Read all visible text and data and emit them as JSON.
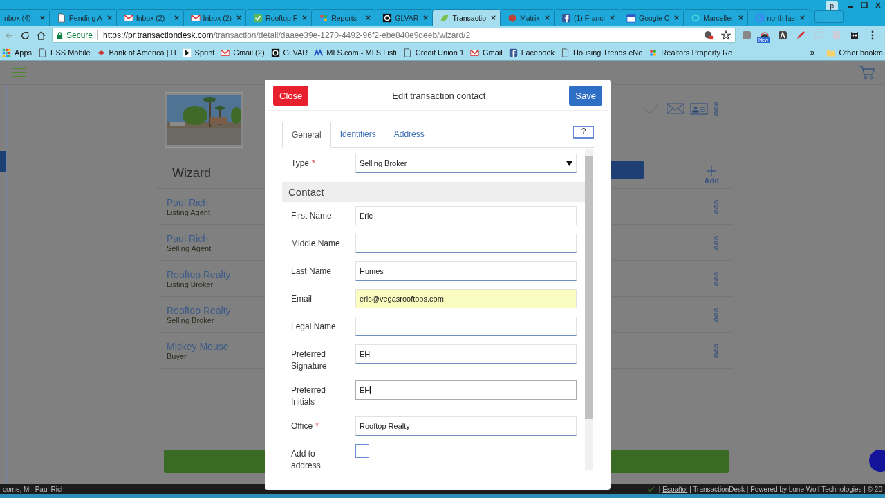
{
  "window": {
    "user_badge": "p"
  },
  "tabs": [
    {
      "title": "Inbox (4) -",
      "selected": false
    },
    {
      "title": "Pending A",
      "kind": "doc",
      "selected": false
    },
    {
      "title": "Inbox (2) -",
      "kind": "mail",
      "selected": false
    },
    {
      "title": "Inbox (2)",
      "kind": "mail",
      "selected": false
    },
    {
      "title": "Rooftop F",
      "kind": "check",
      "selected": false
    },
    {
      "title": "Reports -",
      "kind": "dots",
      "selected": false
    },
    {
      "title": "GLVAR",
      "kind": "box",
      "selected": false
    },
    {
      "title": "Transactio",
      "kind": "leaf",
      "selected": true
    },
    {
      "title": "Matrix",
      "kind": "cube",
      "selected": false
    },
    {
      "title": "(1) Franci",
      "kind": "social",
      "selected": false
    },
    {
      "title": "Google C",
      "kind": "calendar",
      "selected": false
    },
    {
      "title": "Marceller",
      "kind": "ring",
      "selected": false
    },
    {
      "title": "north las",
      "kind": "globe",
      "selected": false
    }
  ],
  "toolbar": {
    "secure_label": "Secure",
    "url_host": "https://pr.transactiondesk.com",
    "url_path": "/transaction/detail/daaee39e-1270-4492-96f2-ebe840e9deeb/wizard/2",
    "extension_badge": "New"
  },
  "bookmarks": [
    {
      "label": "Apps",
      "kind": "grid"
    },
    {
      "label": "ESS Mobile",
      "kind": "doc"
    },
    {
      "label": "Bank of America | H",
      "kind": "flag"
    },
    {
      "label": "Sprint",
      "kind": "play"
    },
    {
      "label": "Gmail (2)",
      "kind": "mail"
    },
    {
      "label": "GLVAR",
      "kind": "box"
    },
    {
      "label": "MLS.com - MLS Listi",
      "kind": "wave"
    },
    {
      "label": "Credit Union 1",
      "kind": "doc"
    },
    {
      "label": "Gmail",
      "kind": "mail"
    },
    {
      "label": "Facebook",
      "kind": "social"
    },
    {
      "label": "Housing Trends eNe",
      "kind": "doc"
    },
    {
      "label": "Realtors Property Re",
      "kind": "dots"
    }
  ],
  "bookmarks_overflow": "»",
  "other_bookmarks": "Other bookm",
  "page": {
    "wizard_title": "Wizard",
    "add_label": "Add",
    "contacts": [
      {
        "name": "Paul Rich",
        "role": "Listing Agent"
      },
      {
        "name": "Paul Rich",
        "role": "Selling Agent"
      },
      {
        "name": "Rooftop Realty",
        "role": "Listing Broker"
      },
      {
        "name": "Rooftop Realty",
        "role": "Selling Broker"
      },
      {
        "name": "Mickey Mouse",
        "role": "Buyer"
      }
    ],
    "welcome": "come, Mr. Paul Rich",
    "footer_prefix": "|",
    "footer_link": "Español",
    "footer_text": "| TransactionDesk | Powered by Lone Wolf Technologies | © 20"
  },
  "dialog": {
    "close": "Close",
    "title": "Edit transaction contact",
    "save": "Save",
    "tabs": [
      {
        "label": "General",
        "selected": true
      },
      {
        "label": "Identifiers",
        "selected": false
      },
      {
        "label": "Address",
        "selected": false
      }
    ],
    "help": "?",
    "required_mark": "*",
    "fields": [
      {
        "kind": "select",
        "label": "Type",
        "required": true,
        "value": "Selling Broker"
      },
      {
        "kind": "section",
        "label": "Contact"
      },
      {
        "kind": "text",
        "label": "First Name",
        "required": false,
        "autofilled": false,
        "focused": false,
        "value": "Eric"
      },
      {
        "kind": "text",
        "label": "Middle Name",
        "required": false,
        "autofilled": false,
        "focused": false
      },
      {
        "kind": "text",
        "label": "Last Name",
        "required": false,
        "autofilled": false,
        "focused": false,
        "value": "Humes"
      },
      {
        "kind": "text",
        "label": "Email",
        "required": false,
        "autofilled": true,
        "focused": false,
        "value": "eric@vegasrooftops.com"
      },
      {
        "kind": "text",
        "label": "Legal Name",
        "required": false,
        "autofilled": false,
        "focused": false
      },
      {
        "kind": "text",
        "label": "Preferred Signature",
        "required": false,
        "autofilled": false,
        "focused": false,
        "value": "EH"
      },
      {
        "kind": "text",
        "label": "Preferred Initials",
        "required": false,
        "autofilled": false,
        "focused": true,
        "value": "EH"
      },
      {
        "kind": "text",
        "label": "Office",
        "required": true,
        "autofilled": false,
        "focused": false,
        "value": "Rooftop Realty"
      },
      {
        "kind": "checkbox",
        "label": "Add to address",
        "required": false,
        "checked": false
      }
    ]
  }
}
